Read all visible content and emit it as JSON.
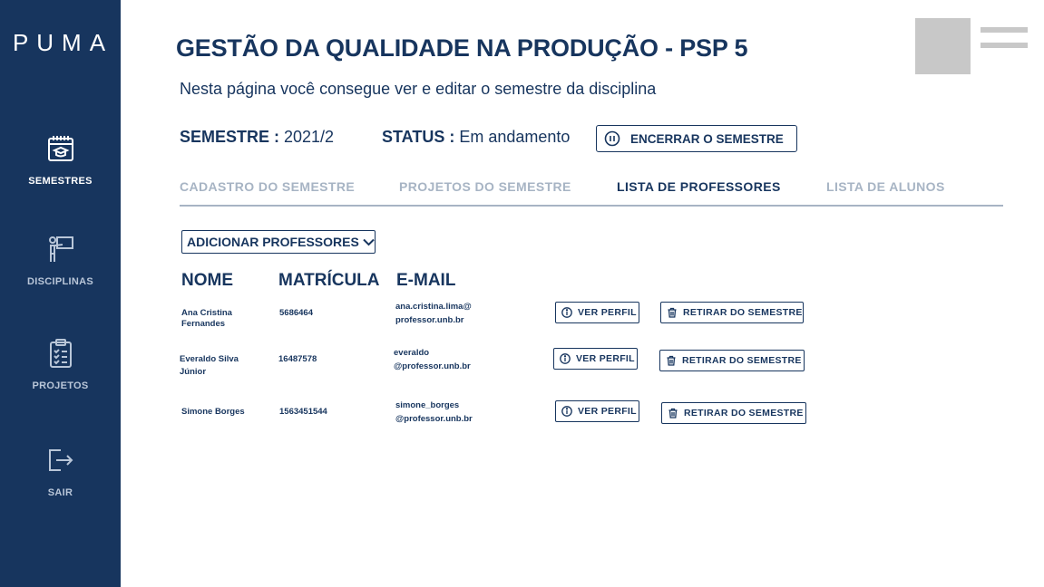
{
  "app": {
    "logo": "PUMA"
  },
  "sidebar": {
    "items": [
      {
        "label": "SEMESTRES",
        "icon": "calendar-icon",
        "active": true
      },
      {
        "label": "DISCIPLINAS",
        "icon": "teacher-board-icon",
        "active": false
      },
      {
        "label": "PROJETOS",
        "icon": "clipboard-list-icon",
        "active": false
      },
      {
        "label": "SAIR",
        "icon": "logout-icon",
        "active": false
      }
    ]
  },
  "header": {
    "title": "GESTÃO DA QUALIDADE NA PRODUÇÃO - PSP 5",
    "subtitle": "Nesta página você consegue ver e editar o semestre da disciplina"
  },
  "info": {
    "semester_label": "SEMESTRE :",
    "semester_value": " 2021/2",
    "status_label": "STATUS :",
    "status_value": " Em andamento",
    "end_button": "ENCERRAR O SEMESTRE"
  },
  "tabs": [
    {
      "label": "CADASTRO DO SEMESTRE",
      "active": false
    },
    {
      "label": "PROJETOS DO SEMESTRE",
      "active": false
    },
    {
      "label": "LISTA DE PROFESSORES",
      "active": true
    },
    {
      "label": "LISTA DE ALUNOS",
      "active": false
    }
  ],
  "professors": {
    "add_button": "ADICIONAR PROFESSORES",
    "columns": [
      "NOME",
      "MATRÍCULA",
      "E-MAIL"
    ],
    "view_label": "VER PERFIL",
    "remove_label": "RETIRAR DO SEMESTRE",
    "rows": [
      {
        "name_line1": "Ana Cristina",
        "name_line2": "Fernandes",
        "registration": "5686464",
        "email_line1": "ana.cristina.lima@",
        "email_line2": "professor.unb.br"
      },
      {
        "name_line1": "Everaldo Silva",
        "name_line2": "Júnior",
        "registration": "16487578",
        "email_line1": "everaldo",
        "email_line2": "@professor.unb.br"
      },
      {
        "name_line1": "Simone Borges",
        "name_line2": "",
        "registration": "1563451544",
        "email_line1": "simone_borges",
        "email_line2": "@professor.unb.br"
      }
    ]
  },
  "colors": {
    "sidebar": "#17355e",
    "primary": "#17355e",
    "muted": "#a7b4c4",
    "placeholder": "#c8c8c8"
  }
}
